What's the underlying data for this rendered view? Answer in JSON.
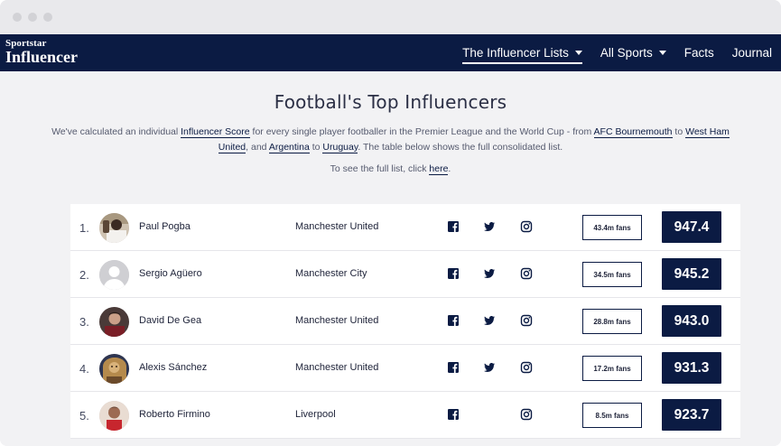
{
  "nav": {
    "brand_top": "Sportstar",
    "brand_bottom": "Influencer",
    "items": [
      {
        "label": "The Influencer Lists",
        "dropdown": true,
        "active": true
      },
      {
        "label": "All Sports",
        "dropdown": true,
        "active": false
      },
      {
        "label": "Facts",
        "dropdown": false,
        "active": false
      },
      {
        "label": "Journal",
        "dropdown": false,
        "active": false
      }
    ]
  },
  "hero": {
    "title": "Football's Top Influencers",
    "intro_1": "We've calculated an individual ",
    "link_score": "Influencer Score",
    "intro_2": " for every single player footballer in the Premier League and the World Cup - from ",
    "link_bournemouth": "AFC Bournemouth",
    "intro_3": " to ",
    "link_westham": "West Ham United",
    "intro_4": ", and ",
    "link_argentina": "Argentina",
    "intro_5": " to ",
    "link_uruguay": "Uruguay",
    "intro_6": ". The table below shows the full consolidated list.",
    "see_full_prefix": "To see the full list, click ",
    "see_full_link": "here",
    "see_full_suffix": "."
  },
  "colors": {
    "navy": "#0b1b43",
    "page_bg": "#f2f2f4"
  },
  "players": [
    {
      "rank": "1.",
      "name": "Paul Pogba",
      "club": "Manchester United",
      "facebook": true,
      "twitter": true,
      "instagram": true,
      "fans": "43.4m fans",
      "score": "947.4",
      "avatar": "photo-pogba"
    },
    {
      "rank": "2.",
      "name": "Sergio Agüero",
      "club": "Manchester City",
      "facebook": true,
      "twitter": true,
      "instagram": true,
      "fans": "34.5m fans",
      "score": "945.2",
      "avatar": "placeholder"
    },
    {
      "rank": "3.",
      "name": "David De Gea",
      "club": "Manchester United",
      "facebook": true,
      "twitter": true,
      "instagram": true,
      "fans": "28.8m fans",
      "score": "943.0",
      "avatar": "photo-degea"
    },
    {
      "rank": "4.",
      "name": "Alexis Sánchez",
      "club": "Manchester United",
      "facebook": true,
      "twitter": true,
      "instagram": true,
      "fans": "17.2m fans",
      "score": "931.3",
      "avatar": "photo-sanchez"
    },
    {
      "rank": "5.",
      "name": "Roberto Firmino",
      "club": "Liverpool",
      "facebook": true,
      "twitter": false,
      "instagram": true,
      "fans": "8.5m fans",
      "score": "923.7",
      "avatar": "photo-firmino"
    }
  ]
}
